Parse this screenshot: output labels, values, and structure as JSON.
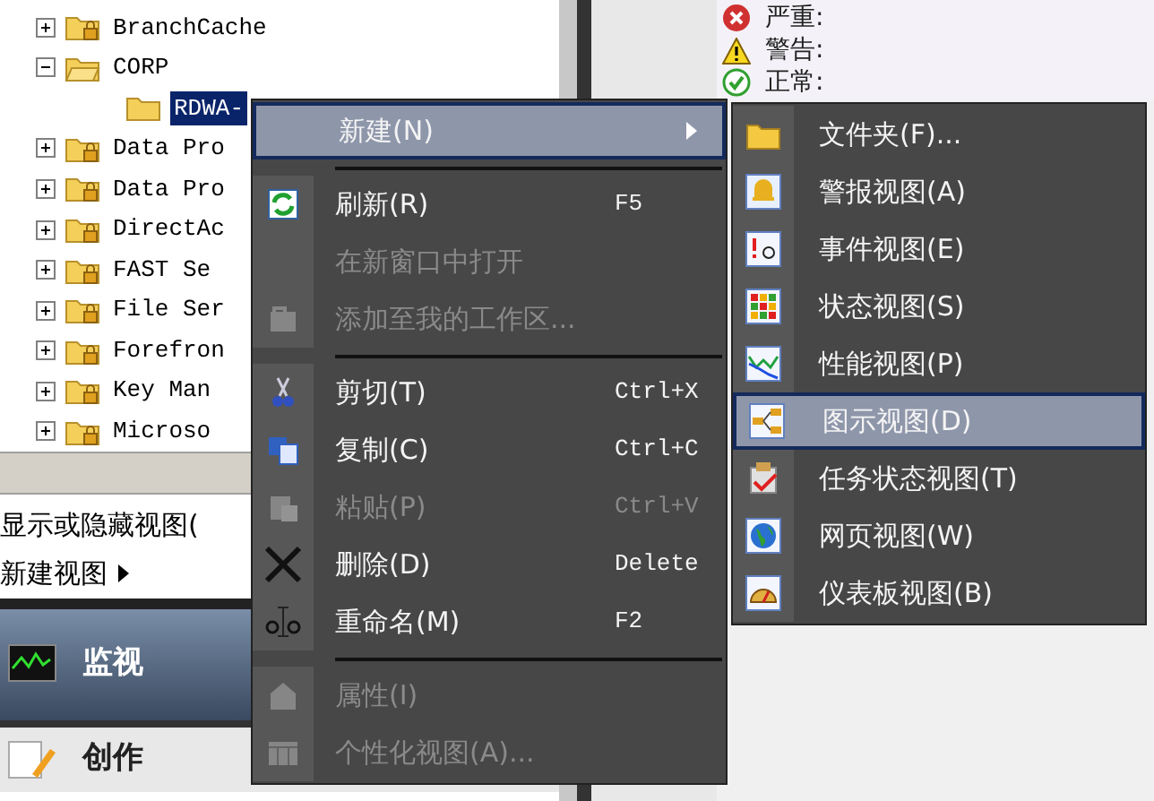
{
  "tree": [
    {
      "label": "BranchCache",
      "expanded": false,
      "selected": false
    },
    {
      "label": "CORP",
      "expanded": true,
      "selected": false,
      "children": [
        {
          "label": "RDWA-",
          "selected": true
        }
      ]
    },
    {
      "label": "Data Pro",
      "expanded": false,
      "selected": false
    },
    {
      "label": "Data Pro",
      "expanded": false,
      "selected": false
    },
    {
      "label": "DirectAc",
      "expanded": false,
      "selected": false
    },
    {
      "label": "FAST Se",
      "expanded": false,
      "selected": false
    },
    {
      "label": "File Ser",
      "expanded": false,
      "selected": false
    },
    {
      "label": "Forefron",
      "expanded": false,
      "selected": false
    },
    {
      "label": "Key Man",
      "expanded": false,
      "selected": false
    },
    {
      "label": "Microso",
      "expanded": false,
      "selected": false
    }
  ],
  "view_links": [
    {
      "label": "显示或隐藏视图(",
      "submenu": false
    },
    {
      "label": "新建视图",
      "submenu": true
    }
  ],
  "nav": [
    {
      "label": "监视",
      "selected": true
    },
    {
      "label": "创作",
      "selected": false
    }
  ],
  "legend": [
    {
      "label": "严重:",
      "kind": "error"
    },
    {
      "label": "警告:",
      "kind": "warning"
    },
    {
      "label": "正常:",
      "kind": "ok"
    }
  ],
  "context_menu": [
    {
      "kind": "item",
      "label": "新建(N)",
      "submenu": true,
      "selected": true,
      "disabled": false
    },
    {
      "kind": "separator"
    },
    {
      "kind": "item",
      "label": "刷新(R)",
      "shortcut": "F5",
      "selected": false,
      "disabled": false
    },
    {
      "kind": "item",
      "label": "在新窗口中打开",
      "selected": false,
      "disabled": true
    },
    {
      "kind": "item",
      "label": "添加至我的工作区...",
      "selected": false,
      "disabled": true
    },
    {
      "kind": "separator"
    },
    {
      "kind": "item",
      "label": "剪切(T)",
      "shortcut": "Ctrl+X",
      "selected": false,
      "disabled": false
    },
    {
      "kind": "item",
      "label": "复制(C)",
      "shortcut": "Ctrl+C",
      "selected": false,
      "disabled": false
    },
    {
      "kind": "item",
      "label": "粘贴(P)",
      "shortcut": "Ctrl+V",
      "selected": false,
      "disabled": true
    },
    {
      "kind": "item",
      "label": "删除(D)",
      "shortcut": "Delete",
      "selected": false,
      "disabled": false
    },
    {
      "kind": "item",
      "label": "重命名(M)",
      "shortcut": "F2",
      "selected": false,
      "disabled": false
    },
    {
      "kind": "separator"
    },
    {
      "kind": "item",
      "label": "属性(I)",
      "selected": false,
      "disabled": true
    },
    {
      "kind": "item",
      "label": "个性化视图(A)...",
      "selected": false,
      "disabled": true
    }
  ],
  "submenu": [
    {
      "label": "文件夹(F)...",
      "selected": false
    },
    {
      "label": "警报视图(A)",
      "selected": false
    },
    {
      "label": "事件视图(E)",
      "selected": false
    },
    {
      "label": "状态视图(S)",
      "selected": false
    },
    {
      "label": "性能视图(P)",
      "selected": false
    },
    {
      "label": "图示视图(D)",
      "selected": true
    },
    {
      "label": "任务状态视图(T)",
      "selected": false
    },
    {
      "label": "网页视图(W)",
      "selected": false
    },
    {
      "label": "仪表板视图(B)",
      "selected": false
    }
  ]
}
